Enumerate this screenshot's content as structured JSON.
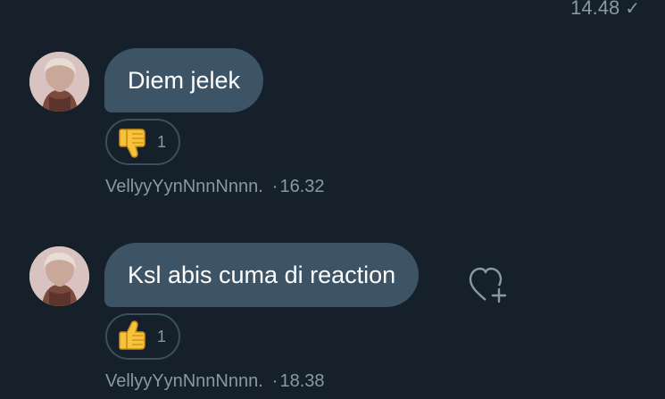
{
  "top_status": {
    "time": "14.48",
    "check_icon": "single-check-icon"
  },
  "messages": [
    {
      "text": "Diem jelek",
      "reaction": {
        "icon": "thumbs-down-emoji",
        "count": "1"
      },
      "sender": "VellyyYynNnnNnnn.",
      "separator": "·",
      "time": "16.32"
    },
    {
      "text": "Ksl abis cuma di reaction",
      "reaction": {
        "icon": "thumbs-up-emoji",
        "count": "1"
      },
      "sender": "VellyyYynNnnNnnn.",
      "separator": "·",
      "time": "18.38",
      "action_icon": "heart-plus-icon"
    }
  ],
  "colors": {
    "background": "#15202b",
    "bubble": "#3d5466",
    "muted_text": "#8899a6"
  }
}
